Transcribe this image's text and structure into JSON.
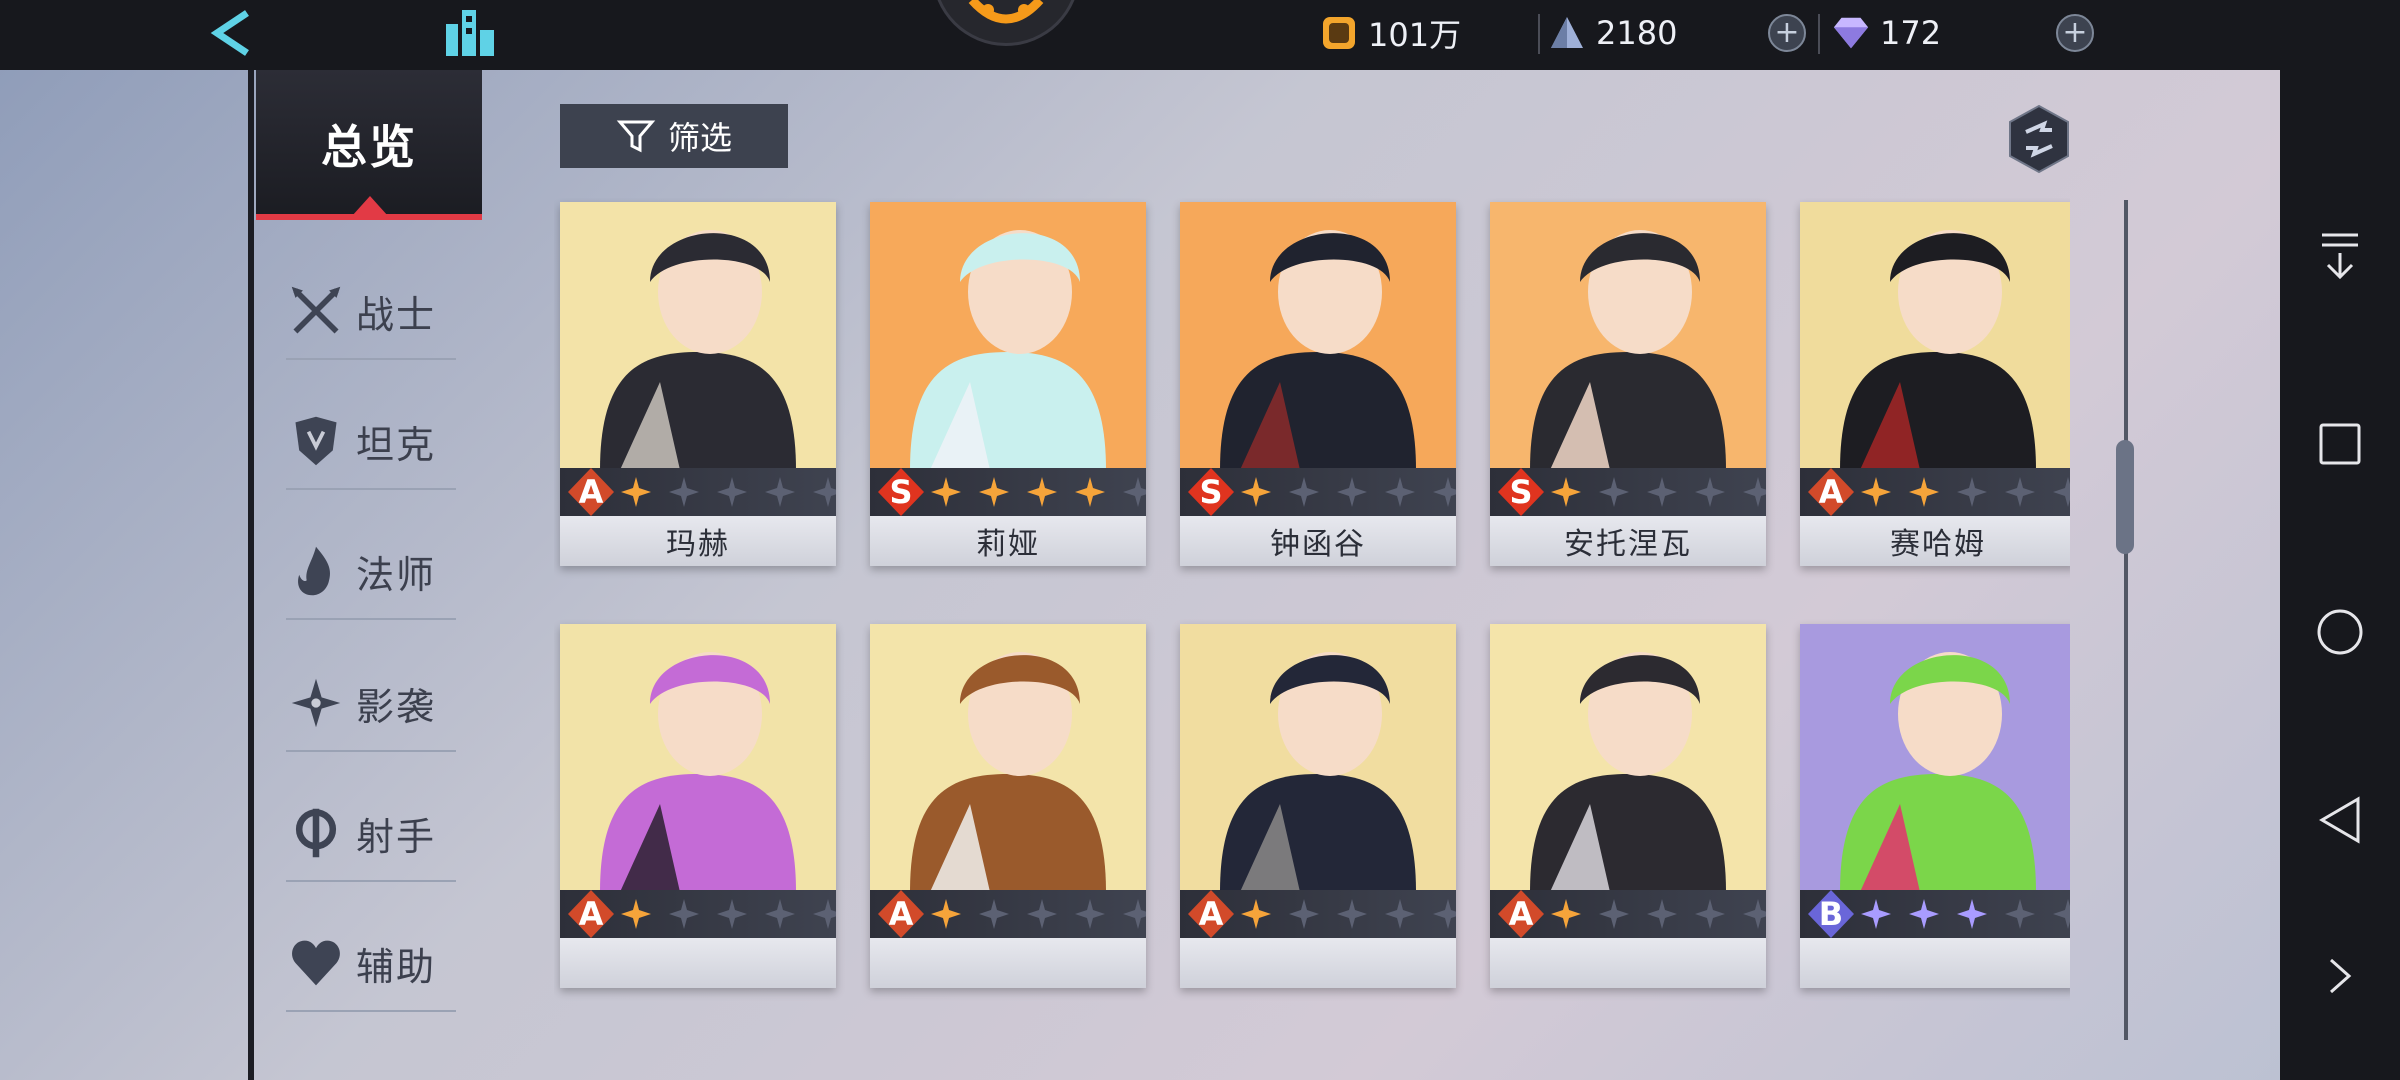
{
  "topbar": {
    "resources": [
      {
        "name": "coin",
        "value": "101万"
      },
      {
        "name": "crystal",
        "value": "2180"
      },
      {
        "name": "diamond",
        "value": "172"
      }
    ]
  },
  "sidebar": {
    "overview_label": "总览",
    "roles": [
      {
        "id": "warrior",
        "label": "战士",
        "icon": "crossed-swords-icon"
      },
      {
        "id": "tank",
        "label": "坦克",
        "icon": "armor-icon"
      },
      {
        "id": "mage",
        "label": "法师",
        "icon": "flame-icon"
      },
      {
        "id": "assassin",
        "label": "影袭",
        "icon": "shuriken-icon"
      },
      {
        "id": "marksman",
        "label": "射手",
        "icon": "crosshair-icon"
      },
      {
        "id": "support",
        "label": "辅助",
        "icon": "heart-icon"
      }
    ]
  },
  "toolbar": {
    "filter_label": "筛选"
  },
  "heroes": [
    {
      "name": "玛赫",
      "rank": "A",
      "stars": 1,
      "max_stars": 5,
      "palette": [
        "#f3e3a8",
        "#2b2b33",
        "#c9c3bc"
      ]
    },
    {
      "name": "莉娅",
      "rank": "S",
      "stars": 4,
      "max_stars": 5,
      "palette": [
        "#f7a95a",
        "#c9f0ee",
        "#eef2f7"
      ]
    },
    {
      "name": "钟函谷",
      "rank": "S",
      "stars": 1,
      "max_stars": 5,
      "palette": [
        "#f6a85a",
        "#20232f",
        "#8b2a2a"
      ]
    },
    {
      "name": "安托涅瓦",
      "rank": "S",
      "stars": 1,
      "max_stars": 5,
      "palette": [
        "#f7b66d",
        "#2a2a30",
        "#f2d8c8"
      ]
    },
    {
      "name": "赛哈姆",
      "rank": "A",
      "stars": 2,
      "max_stars": 5,
      "palette": [
        "#f0dc9c",
        "#1d1d22",
        "#a42626"
      ]
    },
    {
      "name": "",
      "rank": "A",
      "stars": 1,
      "max_stars": 5,
      "palette": [
        "#f2e3a8",
        "#c46bd6",
        "#2c2030"
      ]
    },
    {
      "name": "",
      "rank": "A",
      "stars": 1,
      "max_stars": 5,
      "palette": [
        "#f3e4aa",
        "#9a5a2c",
        "#f1f1ef"
      ]
    },
    {
      "name": "",
      "rank": "A",
      "stars": 1,
      "max_stars": 5,
      "palette": [
        "#f1dda0",
        "#232738",
        "#8b8a88"
      ]
    },
    {
      "name": "",
      "rank": "A",
      "stars": 1,
      "max_stars": 5,
      "palette": [
        "#f4e4aa",
        "#2c2a30",
        "#d9d6dc"
      ]
    },
    {
      "name": "",
      "rank": "B",
      "stars": 3,
      "max_stars": 5,
      "palette": [
        "#a89adf",
        "#7bd64a",
        "#e3336d"
      ]
    }
  ],
  "colors": {
    "rank_A": "#d24a2a",
    "rank_S": "#e0341f",
    "rank_B": "#6a66d9",
    "star_gold": "#f6a43a",
    "star_purple": "#a99cff",
    "star_empty": "#5c6173"
  }
}
